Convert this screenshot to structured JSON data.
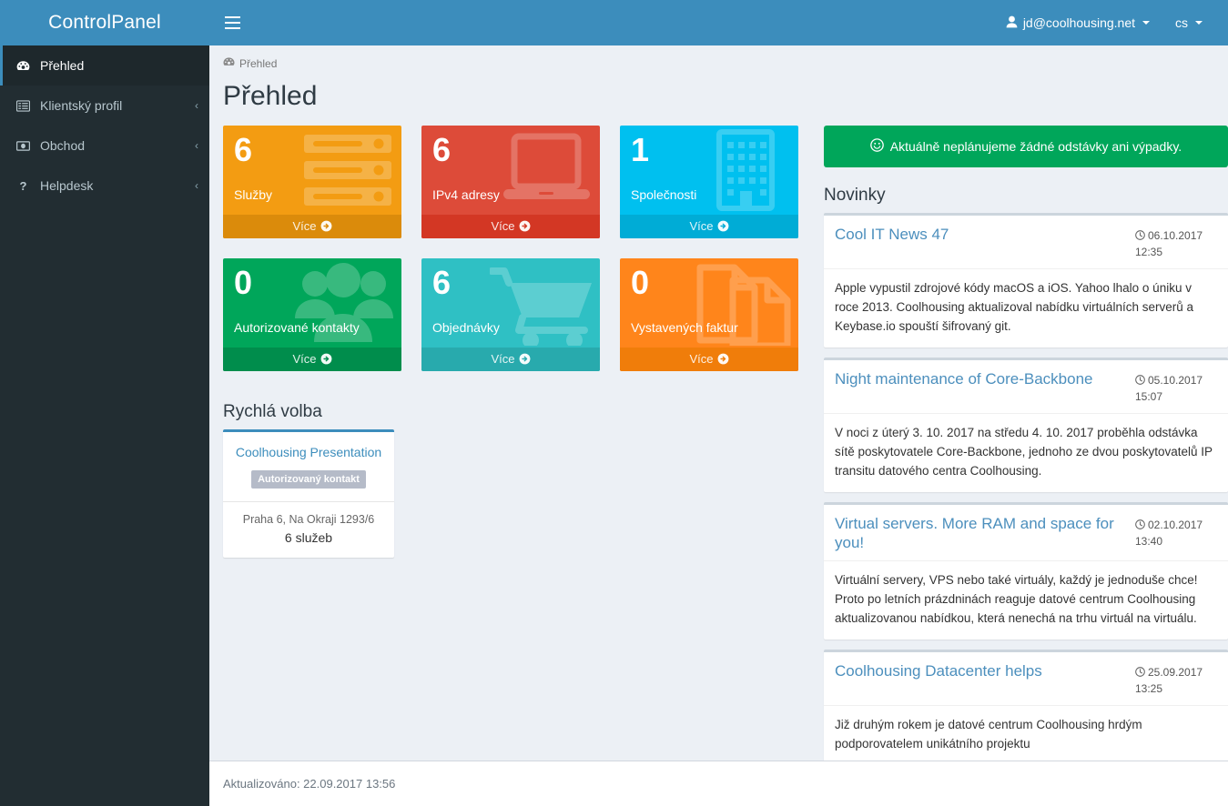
{
  "brand": {
    "title": "ControlPanel"
  },
  "colors": {
    "primary": "#3c8dbc",
    "sidebar_bg": "#222d32",
    "sidebar_active_bg": "#1e282c",
    "content_bg": "#ecf0f5",
    "success": "#00a65a",
    "tile_yellow": "#f39c12",
    "tile_red": "#dd4b39",
    "tile_aqua": "#00c0ef",
    "tile_green": "#00a65a",
    "tile_teal": "#2fc0c4",
    "tile_orange": "#ff851b",
    "link": "#3c8dbc"
  },
  "sidebar": {
    "items": [
      {
        "label": "Přehled",
        "icon": "dashboard-icon",
        "arrow": "",
        "active": true
      },
      {
        "label": "Klientský profil",
        "icon": "list-alt-icon",
        "arrow": "‹",
        "active": false
      },
      {
        "label": "Obchod",
        "icon": "money-icon",
        "arrow": "‹",
        "active": false
      },
      {
        "label": "Helpdesk",
        "icon": "question-icon",
        "arrow": "‹",
        "active": false
      }
    ]
  },
  "navbar": {
    "menu_toggle": "hamburger-icon",
    "user": "jd@coolhousing.net",
    "language": "cs"
  },
  "breadcrumb": {
    "icon": "dashboard-icon",
    "label": "Přehled"
  },
  "page": {
    "title": "Přehled"
  },
  "tiles": [
    {
      "number": "6",
      "label": "Služby",
      "more": "Více",
      "color": "#f39c12",
      "foot_color": "#db8b0b",
      "icon": "server-icon"
    },
    {
      "number": "6",
      "label": "IPv4 adresy",
      "more": "Více",
      "color": "#dd4b39",
      "foot_color": "#d33724",
      "icon": "laptop-icon"
    },
    {
      "number": "1",
      "label": "Společnosti",
      "more": "Více",
      "color": "#00c0ef",
      "foot_color": "#00acd6",
      "icon": "building-icon"
    },
    {
      "number": "0",
      "label": "Autorizované kontakty",
      "more": "Více",
      "color": "#00a65a",
      "foot_color": "#008d4c",
      "icon": "users-icon"
    },
    {
      "number": "6",
      "label": "Objednávky",
      "more": "Více",
      "color": "#2fc0c4",
      "foot_color": "#28aaad",
      "icon": "cart-icon"
    },
    {
      "number": "0",
      "label": "Vystavených faktur",
      "more": "Více",
      "color": "#ff851b",
      "foot_color": "#f07d0a",
      "icon": "files-icon"
    }
  ],
  "quick_choice": {
    "heading": "Rychlá volba",
    "card": {
      "title": "Coolhousing Presentation",
      "badge": "Autorizovaný kontakt",
      "address": "Praha 6, Na Okraji 1293/6",
      "services": "6 služeb"
    }
  },
  "alert": {
    "icon": "smiley-icon",
    "text": "Aktuálně neplánujeme žádné odstávky ani výpadky."
  },
  "news": {
    "heading": "Novinky",
    "items": [
      {
        "title": "Cool IT News 47",
        "date": "06.10.2017",
        "time": "12:35",
        "body": "Apple vypustil zdrojové kódy macOS a iOS. Yahoo lhalo o úniku v roce 2013. Coolhousing aktualizoval nabídku virtuálních serverů a Keybase.io spouští šifrovaný git."
      },
      {
        "title": "Night maintenance of Core-Backbone",
        "date": "05.10.2017",
        "time": "15:07",
        "body": "V noci z úterý 3. 10. 2017 na středu 4. 10. 2017 proběhla odstávka sítě poskytovatele Core-Backbone, jednoho ze dvou poskytovatelů IP transitu datového centra Coolhousing."
      },
      {
        "title": "Virtual servers. More RAM and space for you!",
        "date": "02.10.2017",
        "time": "13:40",
        "body": "Virtuální servery, VPS nebo také virtuály, každý je jednoduše chce! Proto po letních prázdninách reaguje datové centrum Coolhousing aktualizovanou nabídkou, která nenechá na trhu virtuál na virtuálu."
      },
      {
        "title": "Coolhousing Datacenter helps",
        "date": "25.09.2017",
        "time": "13:25",
        "body": "Již druhým rokem je datové centrum Coolhousing hrdým podporovatelem unikátního projektu"
      }
    ]
  },
  "footer": {
    "updated": "Aktualizováno: 22.09.2017 13:56"
  }
}
